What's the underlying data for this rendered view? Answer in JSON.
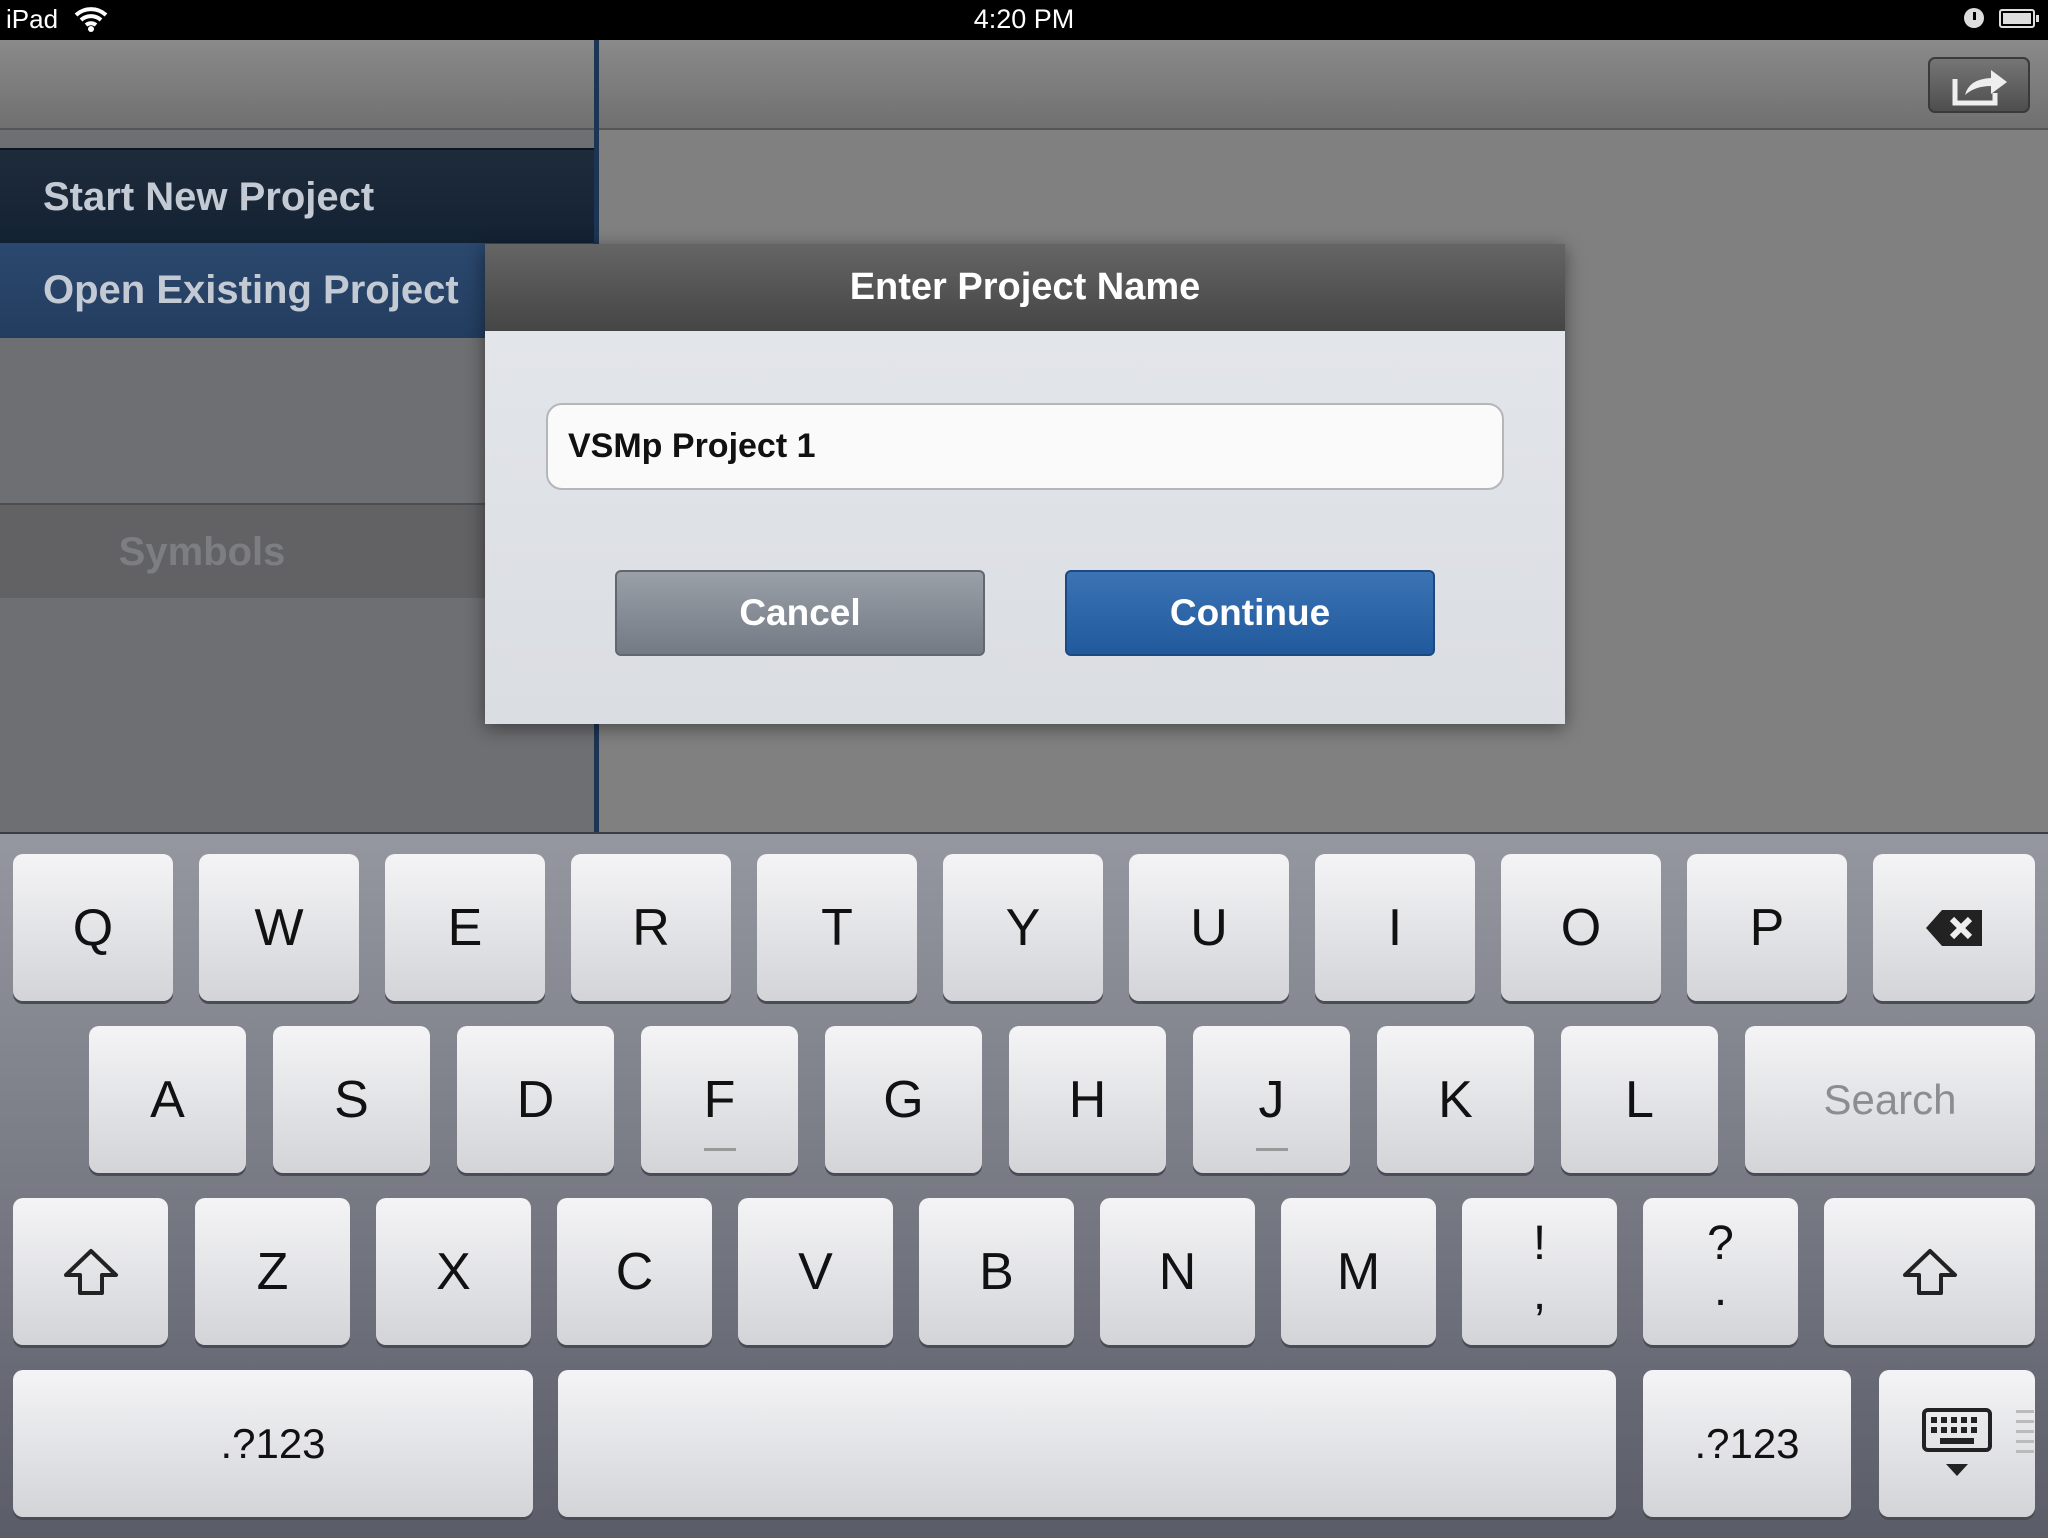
{
  "status_bar": {
    "device": "iPad",
    "time": "4:20 PM"
  },
  "sidebar": {
    "items": [
      {
        "label": "Start New Project"
      },
      {
        "label": "Open Existing Project"
      }
    ],
    "section_header": "Symbols"
  },
  "dialog": {
    "title": "Enter Project Name",
    "input_value": "VSMp Project 1",
    "cancel_label": "Cancel",
    "continue_label": "Continue"
  },
  "keyboard": {
    "row1": [
      "Q",
      "W",
      "E",
      "R",
      "T",
      "Y",
      "U",
      "I",
      "O",
      "P"
    ],
    "row2": [
      "A",
      "S",
      "D",
      "F",
      "G",
      "H",
      "J",
      "K",
      "L"
    ],
    "row3": [
      "Z",
      "X",
      "C",
      "V",
      "B",
      "N",
      "M"
    ],
    "punct1_top": "!",
    "punct1_bottom": ",",
    "punct2_top": "?",
    "punct2_bottom": ".",
    "return_label": "Search",
    "numbers_left": ".?123",
    "numbers_right": ".?123",
    "icons": [
      "backspace-icon",
      "shift-icon",
      "keyboard-dismiss-icon",
      "share-icon",
      "wifi-icon",
      "battery-icon",
      "clock-icon"
    ]
  }
}
